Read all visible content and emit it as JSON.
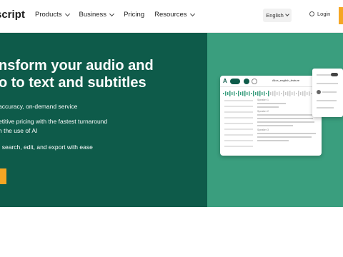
{
  "header": {
    "logo": "script",
    "nav": [
      {
        "label": "Products",
        "has_dropdown": true
      },
      {
        "label": "Business",
        "has_dropdown": true
      },
      {
        "label": "Pricing",
        "has_dropdown": false
      },
      {
        "label": "Resources",
        "has_dropdown": true
      }
    ],
    "language": "English",
    "login": "Login"
  },
  "hero": {
    "title": "nsform your audio and\no to text and subtitles",
    "bullets": [
      "accuracy, on-demand service",
      "etitive pricing with the fastest turnaround\nh the use of AI",
      ", search, edit, and export with ease"
    ]
  },
  "mockup": {
    "logo": "A",
    "file_name": "Alice_english_feature",
    "speaker_labels": [
      "Speaker 1",
      "Speaker 2",
      "Speaker 3"
    ]
  },
  "colors": {
    "brand_dark": "#0e5b4a",
    "brand_light": "#3a9e7e",
    "accent": "#f5a623"
  }
}
